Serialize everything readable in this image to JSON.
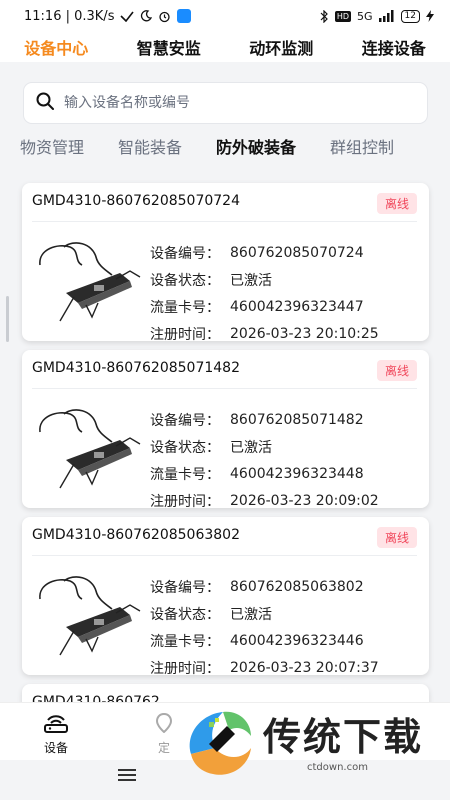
{
  "status_bar": {
    "time_speed": "11:16 | 0.3K/s",
    "signal": "5G",
    "hd": "HD",
    "battery": "12"
  },
  "top_nav": {
    "items": [
      {
        "label": "设备中心",
        "active": true
      },
      {
        "label": "智慧安监",
        "active": false
      },
      {
        "label": "动环监测",
        "active": false
      },
      {
        "label": "连接设备",
        "active": false
      }
    ]
  },
  "search": {
    "placeholder": "输入设备名称或编号",
    "value": ""
  },
  "category_tabs": [
    {
      "label": "物资管理",
      "active": false
    },
    {
      "label": "智能装备",
      "active": false
    },
    {
      "label": "防外破装备",
      "active": true
    },
    {
      "label": "群组控制",
      "active": false
    }
  ],
  "device_labels": {
    "number": "设备编号：",
    "status": "设备状态：",
    "sim": "流量卡号：",
    "reg_time": "注册时间："
  },
  "devices": [
    {
      "title": "GMD4310-860762085070724",
      "badge": "离线",
      "number": "860762085070724",
      "status": "已激活",
      "sim": "460042396323447",
      "reg_time": "2026-03-23 20:10:25"
    },
    {
      "title": "GMD4310-860762085071482",
      "badge": "离线",
      "number": "860762085071482",
      "status": "已激活",
      "sim": "460042396323448",
      "reg_time": "2026-03-23 20:09:02"
    },
    {
      "title": "GMD4310-860762085063802",
      "badge": "离线",
      "number": "860762085063802",
      "status": "已激活",
      "sim": "460042396323446",
      "reg_time": "2026-03-23 20:07:37"
    },
    {
      "title": "GMD4310-860762"
    }
  ],
  "bottom_tabs": {
    "device": "设备",
    "locate": "定"
  },
  "watermark": {
    "brand": "传统下载",
    "url": "ctdown.com"
  },
  "colors": {
    "accent": "#f58a1f",
    "offline_text": "#f0475b",
    "offline_bg": "#ffe3e6"
  }
}
